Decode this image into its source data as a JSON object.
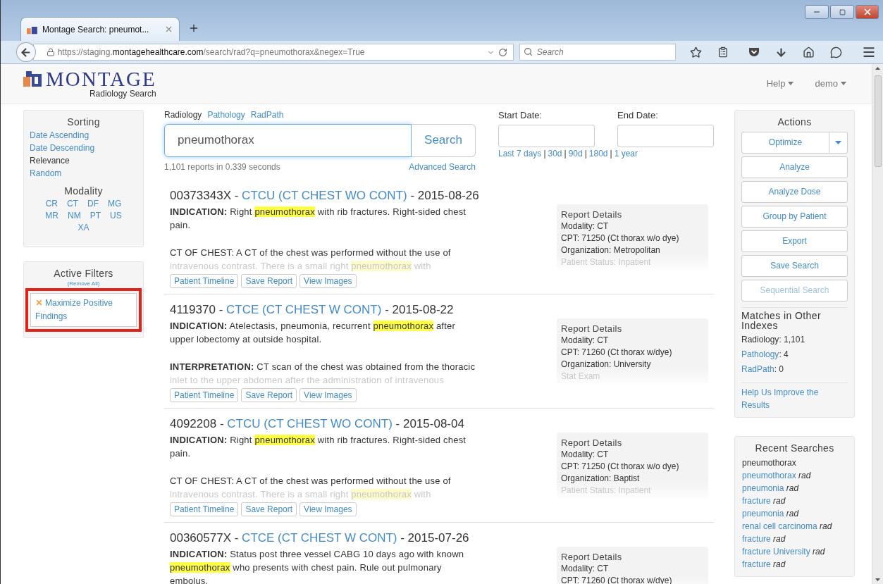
{
  "browser": {
    "tab_title": "Montage Search: pneumot...",
    "url_prefix": "https://staging.",
    "url_domain": "montagehealthcare.com",
    "url_path": "/search/rad?q=pneumothorax&negex=True",
    "search_placeholder": "Search"
  },
  "header": {
    "logo": "MONTAGE",
    "subtitle": "Radiology Search",
    "menus": [
      "Help",
      "demo"
    ]
  },
  "sorting": {
    "title": "Sorting",
    "options": [
      {
        "label": "Date Ascending",
        "selected": false
      },
      {
        "label": "Date Descending",
        "selected": false
      },
      {
        "label": "Relevance",
        "selected": true
      },
      {
        "label": "Random",
        "selected": false
      }
    ]
  },
  "modality": {
    "title": "Modality",
    "items": [
      "CR",
      "CT",
      "DF",
      "MG",
      "MR",
      "NM",
      "PT",
      "US",
      "XA"
    ]
  },
  "active_filters": {
    "title": "Active Filters",
    "remove_all": "(Remove All)",
    "filters": [
      {
        "label": "Maximize Positive Findings",
        "highlighted": true
      }
    ]
  },
  "indexes": [
    {
      "label": "Radiology",
      "selected": true
    },
    {
      "label": "Pathology",
      "selected": false
    },
    {
      "label": "RadPath",
      "selected": false
    }
  ],
  "search": {
    "value": "pneumothorax",
    "button": "Search",
    "stats": "1,101 reports in 0.339 seconds",
    "advanced": "Advanced Search"
  },
  "dates": {
    "start_label": "Start Date:",
    "end_label": "End Date:",
    "separator": "|",
    "presets": [
      "Last 7 days",
      "30d",
      "90d",
      "180d",
      "1 year"
    ]
  },
  "results": [
    {
      "id": "00373343X -",
      "study": "CTCU (CT CHEST WO CONT)",
      "date": "- 2015-08-26",
      "paragraphs": [
        {
          "faded": false,
          "segments": [
            {
              "kind": "bold",
              "text": "INDICATION:"
            },
            {
              "kind": "plain",
              "text": " Right "
            },
            {
              "kind": "highlight",
              "text": "pneumothorax"
            },
            {
              "kind": "plain",
              "text": " with rib fractures. Right-sided chest pain."
            }
          ]
        },
        {
          "faded": false,
          "segments": [
            {
              "kind": "plain",
              "text": "CT OF CHEST: A CT of the chest was performed without the use of"
            }
          ]
        },
        {
          "faded": true,
          "segments": [
            {
              "kind": "plain",
              "text": "intravenous contrast. There is a small right "
            },
            {
              "kind": "highlight",
              "text": "pneumothorax"
            },
            {
              "kind": "plain",
              "text": " with"
            }
          ]
        }
      ],
      "details": {
        "title": "Report Details",
        "lines": [
          {
            "text": "Modality: CT",
            "faded": false
          },
          {
            "text": "CPT: 71250 (Ct thorax w/o dye)",
            "faded": false
          },
          {
            "text": "Organization: Metropolitan",
            "faded": false
          },
          {
            "text": "Patient Status: Inpatient",
            "faded": true
          }
        ]
      },
      "buttons": [
        "Patient Timeline",
        "Save Report",
        "View Images"
      ]
    },
    {
      "id": "4119370 -",
      "study": "CTCE (CT CHEST W CONT)",
      "date": "- 2015-08-22",
      "paragraphs": [
        {
          "faded": false,
          "segments": [
            {
              "kind": "bold",
              "text": "INDICATION:"
            },
            {
              "kind": "plain",
              "text": " Atelectasis, pneumonia, recurrent "
            },
            {
              "kind": "highlight",
              "text": "pneumothorax"
            },
            {
              "kind": "plain",
              "text": " after upper lobectomy at outside hospital."
            }
          ]
        },
        {
          "faded": false,
          "segments": [
            {
              "kind": "bold",
              "text": "INTERPRETATION:"
            },
            {
              "kind": "plain",
              "text": " CT scan of the chest was obtained from the thoracic"
            }
          ]
        },
        {
          "faded": true,
          "segments": [
            {
              "kind": "plain",
              "text": "inlet to the upper abdomen after the administration of intravenous"
            }
          ]
        }
      ],
      "details": {
        "title": "Report Details",
        "lines": [
          {
            "text": "Modality: CT",
            "faded": false
          },
          {
            "text": "CPT: 71260 (Ct thorax w/dye)",
            "faded": false
          },
          {
            "text": "Organization: University",
            "faded": false
          },
          {
            "text": "Stat Exam",
            "faded": true
          }
        ]
      },
      "buttons": [
        "Patient Timeline",
        "Save Report",
        "View Images"
      ]
    },
    {
      "id": "4092208 -",
      "study": "CTCU (CT CHEST WO CONT)",
      "date": "- 2015-08-04",
      "paragraphs": [
        {
          "faded": false,
          "segments": [
            {
              "kind": "bold",
              "text": "INDICATION:"
            },
            {
              "kind": "plain",
              "text": " Right "
            },
            {
              "kind": "highlight",
              "text": "pneumothorax"
            },
            {
              "kind": "plain",
              "text": " with rib fractures. Right-sided chest pain."
            }
          ]
        },
        {
          "faded": false,
          "segments": [
            {
              "kind": "plain",
              "text": "CT OF CHEST: A CT of the chest was performed without the use of"
            }
          ]
        },
        {
          "faded": true,
          "segments": [
            {
              "kind": "plain",
              "text": "intravenous contrast. There is a small right "
            },
            {
              "kind": "highlight",
              "text": "pneumothorax"
            },
            {
              "kind": "plain",
              "text": " with"
            }
          ]
        }
      ],
      "details": {
        "title": "Report Details",
        "lines": [
          {
            "text": "Modality: CT",
            "faded": false
          },
          {
            "text": "CPT: 71250 (Ct thorax w/o dye)",
            "faded": false
          },
          {
            "text": "Organization: Baptist",
            "faded": false
          },
          {
            "text": "Patient Status: Inpatient",
            "faded": true
          }
        ]
      },
      "buttons": [
        "Patient Timeline",
        "Save Report",
        "View Images"
      ]
    },
    {
      "id": "00360577X -",
      "study": "CTCE (CT CHEST W CONT)",
      "date": "- 2015-07-26",
      "paragraphs": [
        {
          "faded": false,
          "segments": [
            {
              "kind": "bold",
              "text": "INDICATION:"
            },
            {
              "kind": "plain",
              "text": " Status post three vessel CABG 10 days ago with known "
            },
            {
              "kind": "highlight",
              "text": "pneumothorax"
            },
            {
              "kind": "plain",
              "text": " who presents with chest pain. Rule out pulmonary embolus."
            }
          ]
        }
      ],
      "details": {
        "title": "Report Details",
        "lines": [
          {
            "text": "Modality: CT",
            "faded": false
          },
          {
            "text": "CPT: 71260 (Ct thorax w/dye)",
            "faded": false
          }
        ]
      }
    }
  ],
  "actions": {
    "title": "Actions",
    "buttons": [
      {
        "label": "Optimize",
        "kind": "split",
        "disabled": false
      },
      {
        "label": "Analyze",
        "kind": "plain",
        "disabled": false
      },
      {
        "label": "Analyze Dose",
        "kind": "plain",
        "disabled": false
      },
      {
        "label": "Group by Patient",
        "kind": "plain",
        "disabled": false
      },
      {
        "label": "Export",
        "kind": "plain",
        "disabled": false
      },
      {
        "label": "Save Search",
        "kind": "plain",
        "disabled": false
      },
      {
        "label": "Sequential Search",
        "kind": "plain",
        "disabled": true
      }
    ]
  },
  "matches": {
    "title": "Matches in Other Indexes",
    "items": [
      {
        "name": "Radiology",
        "count": ": 1,101",
        "linked": false
      },
      {
        "name": "Pathology",
        "count": ": 4",
        "linked": true
      },
      {
        "name": "RadPath",
        "count": ": 0",
        "linked": true
      }
    ],
    "help_link": "Help Us Improve the Results"
  },
  "recent": {
    "title": "Recent Searches",
    "items": [
      {
        "query": "pneumothorax",
        "linked": false
      },
      {
        "query": "pneumothorax",
        "linked": true,
        "tag": "rad"
      },
      {
        "query": "pneumonia",
        "linked": true,
        "tag": "rad"
      },
      {
        "query": "fracture",
        "linked": true,
        "tag": "rad"
      },
      {
        "query": "pneumonia",
        "linked": true,
        "tag": "rad"
      },
      {
        "query": "renal cell carcinoma",
        "linked": true,
        "tag": "rad"
      },
      {
        "query": "fracture",
        "linked": true,
        "tag": "rad"
      },
      {
        "query": "fracture University",
        "linked": true,
        "tag": "rad"
      },
      {
        "query": "fracture",
        "linked": true,
        "tag": "rad"
      }
    ]
  }
}
